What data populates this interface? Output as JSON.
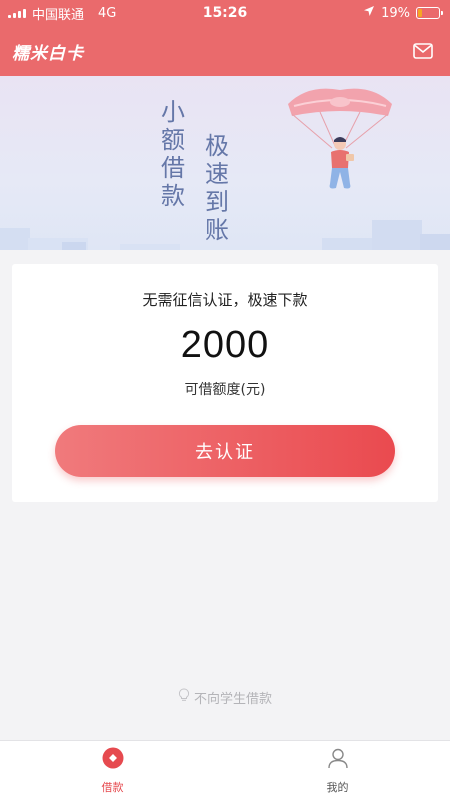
{
  "status_bar": {
    "carrier": "中国联通",
    "network": "4G",
    "time": "15:26",
    "battery_percent": "19%",
    "battery_level": 0.19,
    "icons": [
      "signal-icon",
      "location-arrow-icon",
      "battery-icon"
    ]
  },
  "nav": {
    "app_name": "糯米白卡",
    "icons": [
      "mail-icon"
    ]
  },
  "banner": {
    "text_col1": [
      "小",
      "额",
      "借",
      "款"
    ],
    "text_col2": [
      "极",
      "速",
      "到",
      "账"
    ]
  },
  "card": {
    "slogan": "无需征信认证，极速下款",
    "amount": "2000",
    "amount_label": "可借额度(元)",
    "button_label": "去认证"
  },
  "notice": {
    "text": "不向学生借款",
    "icon": "lightbulb-icon"
  },
  "tabs": [
    {
      "label": "借款",
      "icon": "loan-icon",
      "active": true
    },
    {
      "label": "我的",
      "icon": "profile-icon",
      "active": false
    }
  ],
  "colors": {
    "brand": "#ea6a6c",
    "button_gradient_start": "#f07a7c",
    "button_gradient_end": "#ea4a4f",
    "active_tab": "#e64a4f",
    "banner_text": "#6577a8",
    "battery_low": "#f5a623"
  }
}
